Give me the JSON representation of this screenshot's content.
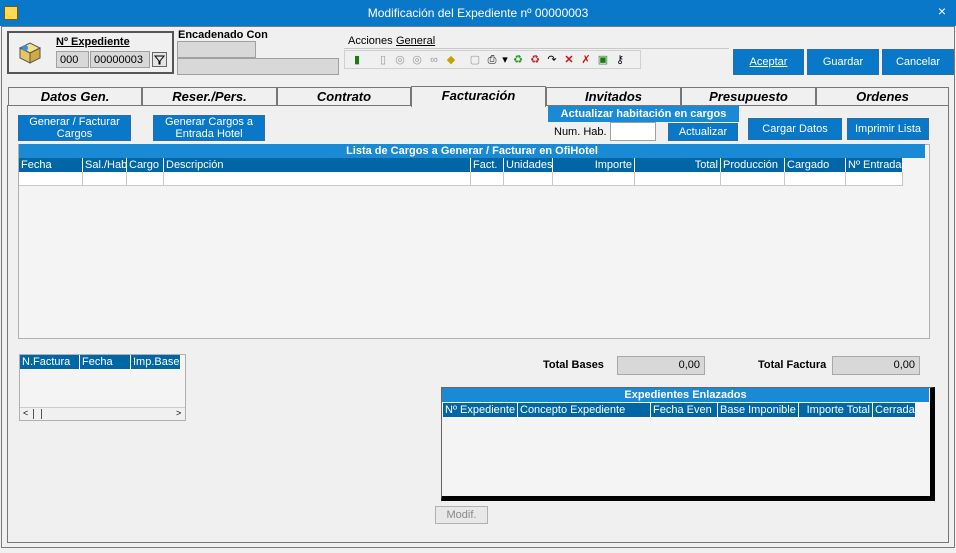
{
  "window": {
    "title": "Modificación del Expediente nº 00000003",
    "close": "×"
  },
  "expediente": {
    "label": "Nº Expediente",
    "serie": "000",
    "numero": "00000003"
  },
  "encadenado": {
    "label": "Encadenado Con"
  },
  "menu": {
    "acciones": "Acciones",
    "general": "General"
  },
  "buttons": {
    "aceptar": "Aceptar",
    "guardar": "Guardar",
    "cancelar": "Cancelar"
  },
  "tabs": [
    "Datos Gen.",
    "Reser./Pers.",
    "Contrato",
    "Facturación",
    "Invitados",
    "Presupuesto",
    "Ordenes"
  ],
  "facturacion": {
    "generar_facturar": "Generar / Facturar Cargos",
    "generar_entrada": "Generar Cargos a Entrada Hotel",
    "actualizar_hab_title": "Actualizar habitación en cargos",
    "num_hab_label": "Num. Hab.",
    "num_hab_value": "",
    "actualizar": "Actualizar",
    "cargar_datos": "Cargar Datos",
    "imprimir_lista": "Imprimir Lista",
    "lista_title": "Lista de Cargos a Generar / Facturar en OfiHotel",
    "columns": [
      "Fecha",
      "Sal./Hab.",
      "Cargo",
      "Descripción",
      "Fact.",
      "Unidades",
      "Importe",
      "Total",
      "Producción",
      "Cargado",
      "Nº Entrada"
    ]
  },
  "facturas": {
    "columns": [
      "N.Factura",
      "Fecha",
      "Imp.Base"
    ]
  },
  "totals": {
    "bases_label": "Total Bases",
    "bases_value": "0,00",
    "factura_label": "Total Factura",
    "factura_value": "0,00"
  },
  "enlazados": {
    "title": "Expedientes Enlazados",
    "columns": [
      "Nº Expediente",
      "Concepto Expediente",
      "Fecha Even",
      "Base Imponible",
      "Importe Total",
      "Cerrada"
    ],
    "modif": "Modif."
  }
}
